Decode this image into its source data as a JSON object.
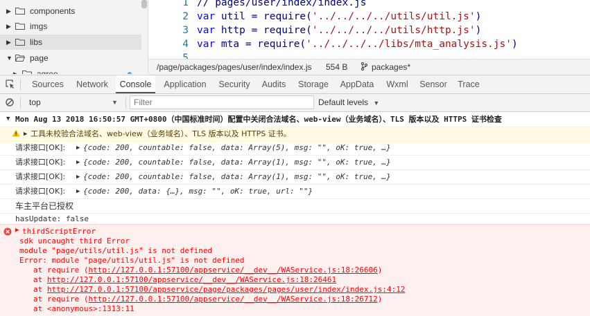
{
  "tree": {
    "items": [
      {
        "label": "components",
        "expanded": false
      },
      {
        "label": "imgs",
        "expanded": false
      },
      {
        "label": "libs",
        "expanded": false
      },
      {
        "label": "page",
        "expanded": true
      },
      {
        "label": "agree",
        "expanded": false
      }
    ]
  },
  "editor": {
    "lines": [
      {
        "n": "1",
        "code": "// pages/user/index/index.js"
      },
      {
        "n": "2",
        "kw": "var",
        "rest": " util = require(",
        "str": "'../../../../utils/util.js'",
        "end": ")"
      },
      {
        "n": "3",
        "kw": "var",
        "rest": " http = require(",
        "str": "'../../../../utils/http.js'",
        "end": ")"
      },
      {
        "n": "4",
        "kw": "var",
        "rest": " mta = require(",
        "str": "'../../../../libs/mta_analysis.js'",
        "end": ")"
      },
      {
        "n": "5",
        "code": ""
      }
    ]
  },
  "status": {
    "path": "/page/packages/pages/user/index/index.js",
    "size": "554 B",
    "branch": "packages*"
  },
  "tabs": [
    "Sources",
    "Network",
    "Console",
    "Application",
    "Security",
    "Audits",
    "Storage",
    "AppData",
    "Wxml",
    "Sensor",
    "Trace"
  ],
  "active_tab": "Console",
  "toolbar": {
    "context": "top",
    "filter_placeholder": "Filter",
    "levels": "Default levels"
  },
  "console": {
    "group_header": "Mon Aug 13 2018 16:50:57 GMT+0800（中国标准时间）配置中关闭合法域名、web-view（业务域名）、TLS 版本以及 HTTPS 证书检查",
    "warning": "工具未校验合法域名、web-view（业务域名）、TLS 版本以及 HTTPS 证书。",
    "logs": [
      {
        "prefix": "请求接口[OK]:",
        "obj": "{code: 200, countable: false, data: Array(5), msg: \"\", oK: true, …}"
      },
      {
        "prefix": "请求接口[OK]:",
        "obj": "{code: 200, countable: false, data: Array(1), msg: \"\", oK: true, …}"
      },
      {
        "prefix": "请求接口[OK]:",
        "obj": "{code: 200, countable: false, data: Array(1), msg: \"\", oK: true, …}"
      },
      {
        "prefix": "请求接口[OK]:",
        "obj": "{code: 200, data: {…}, msg: \"\", oK: true, url: \"\"}"
      }
    ],
    "text1": "车主平台已授权",
    "text2": "hasUpdate: false",
    "error": {
      "title": "thirdScriptError",
      "line1": "sdk uncaught third Error",
      "line2": "module \"page/utils/util.js\" is not defined",
      "line3": "Error: module \"page/utils/util.js\" is not defined",
      "stack": [
        {
          "pre": "at require (",
          "link": "http://127.0.0.1:57100/appservice/__dev__/WAService.js:18:26606",
          "post": ")"
        },
        {
          "pre": "at ",
          "link": "http://127.0.0.1:57100/appservice/__dev__/WAService.js:18:26461",
          "post": ""
        },
        {
          "pre": "at ",
          "link": "http://127.0.0.1:57100/appservice/page/packages/pages/user/index/index.js:4:12",
          "post": ""
        },
        {
          "pre": "at require (",
          "link": "http://127.0.0.1:57100/appservice/__dev__/WAService.js:18:26712",
          "post": ")"
        },
        {
          "pre": "at <anonymous>:1313:11",
          "link": "",
          "post": ""
        }
      ]
    }
  },
  "colors": {
    "error": "#ff0000",
    "warning_bg": "#fffbe5",
    "error_bg": "#fff0f0",
    "link_blue": "#1a73e8"
  }
}
